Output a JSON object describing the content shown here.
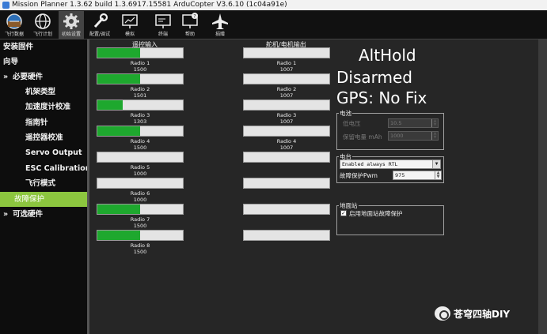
{
  "window": {
    "title": "Mission Planner 1.3.62 build 1.3.6917.15581 ArduCopter V3.6.10 (1c04a91e)"
  },
  "toolbar": [
    {
      "label": "飞行数据",
      "icon": "flight-data-icon"
    },
    {
      "label": "飞行计划",
      "icon": "globe-icon"
    },
    {
      "label": "初始设置",
      "icon": "gear-icon",
      "active": true
    },
    {
      "label": "配置/调试",
      "icon": "wrench-icon"
    },
    {
      "label": "模拟",
      "icon": "monitor-icon"
    },
    {
      "label": "终端",
      "icon": "terminal-icon"
    },
    {
      "label": "帮助",
      "icon": "help-icon"
    },
    {
      "label": "捐赠",
      "icon": "plane-icon"
    }
  ],
  "sidebar": {
    "items": [
      {
        "label": "安装固件"
      },
      {
        "label": "向导"
      },
      {
        "label": "必要硬件",
        "arrow": "»"
      },
      {
        "label": "机架类型"
      },
      {
        "label": "加速度计校准"
      },
      {
        "label": "指南针"
      },
      {
        "label": "遥控器校准"
      },
      {
        "label": "Servo Output"
      },
      {
        "label": "ESC Calibration"
      },
      {
        "label": "飞行模式"
      },
      {
        "label": "故障保护"
      },
      {
        "label": "可选硬件",
        "arrow": "»"
      }
    ]
  },
  "radio_in": {
    "title": "遥控输入",
    "channels": [
      {
        "name": "Radio 1",
        "value": "1500",
        "fill": 0.5
      },
      {
        "name": "Radio 2",
        "value": "1501",
        "fill": 0.5
      },
      {
        "name": "Radio 3",
        "value": "1303",
        "fill": 0.3
      },
      {
        "name": "Radio 4",
        "value": "1500",
        "fill": 0.5
      },
      {
        "name": "Radio 5",
        "value": "1000",
        "fill": 0.0
      },
      {
        "name": "Radio 6",
        "value": "1000",
        "fill": 0.0
      },
      {
        "name": "Radio 7",
        "value": "1500",
        "fill": 0.5
      },
      {
        "name": "Radio 8",
        "value": "1500",
        "fill": 0.5
      }
    ]
  },
  "servo_out": {
    "title": "舵机/电机输出",
    "channels": [
      {
        "name": "Radio 1",
        "value": "1007",
        "fill": 0.0
      },
      {
        "name": "Radio 2",
        "value": "1007",
        "fill": 0.0
      },
      {
        "name": "Radio 3",
        "value": "1007",
        "fill": 0.0
      },
      {
        "name": "Radio 4",
        "value": "1007",
        "fill": 0.0
      },
      {
        "name": "",
        "value": "",
        "fill": 0.0
      },
      {
        "name": "",
        "value": "",
        "fill": 0.0
      },
      {
        "name": "",
        "value": "",
        "fill": 0.0
      },
      {
        "name": "",
        "value": "",
        "fill": 0.0
      }
    ]
  },
  "status": {
    "mode": "AltHold",
    "armed": "Disarmed",
    "gps": "GPS: No Fix"
  },
  "battery": {
    "title": "电池",
    "low_voltage_label": "低电压",
    "low_voltage_value": "10.5",
    "reserved_mah_label": "保留电量 mAh",
    "reserved_mah_value": "1000"
  },
  "radio_failsafe": {
    "title": "电台",
    "mode_value": "Enabled always RTL",
    "pwm_label": "故障保护Pwm",
    "pwm_value": "975"
  },
  "gcs_failsafe": {
    "title": "地面站",
    "checkbox_label": "启用地面站故障保护",
    "checked": true
  },
  "watermark": {
    "text": "苍穹四轴DIY"
  }
}
